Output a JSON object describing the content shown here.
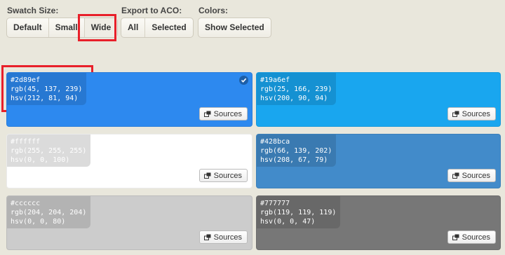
{
  "toolbar": {
    "swatch_size": {
      "label": "Swatch Size:",
      "options": [
        "Default",
        "Small",
        "Wide"
      ],
      "selected": "Wide"
    },
    "export": {
      "label": "Export to ACO:",
      "options": [
        "All",
        "Selected"
      ]
    },
    "colors": {
      "label": "Colors:",
      "show_selected": "Show Selected"
    }
  },
  "swatches": [
    {
      "hex": "#2d89ef",
      "rgb": "rgb(45, 137, 239)",
      "hsv": "hsv(212, 81, 94)",
      "color": "#2d89ef",
      "text_color": "#ffffff",
      "selected": true,
      "sources_label": "Sources"
    },
    {
      "hex": "#19a6ef",
      "rgb": "rgb(25, 166, 239)",
      "hsv": "hsv(200, 90, 94)",
      "color": "#19a6ef",
      "text_color": "#ffffff",
      "selected": false,
      "sources_label": "Sources"
    },
    {
      "hex": "#ffffff",
      "rgb": "rgb(255, 255, 255)",
      "hsv": "hsv(0, 0, 100)",
      "color": "#ffffff",
      "text_color": "#ffffff",
      "selected": false,
      "sources_label": "Sources"
    },
    {
      "hex": "#428bca",
      "rgb": "rgb(66, 139, 202)",
      "hsv": "hsv(208, 67, 79)",
      "color": "#428bca",
      "text_color": "#ffffff",
      "selected": false,
      "sources_label": "Sources"
    },
    {
      "hex": "#cccccc",
      "rgb": "rgb(204, 204, 204)",
      "hsv": "hsv(0, 0, 80)",
      "color": "#cccccc",
      "text_color": "#ffffff",
      "selected": false,
      "sources_label": "Sources"
    },
    {
      "hex": "#777777",
      "rgb": "rgb(119, 119, 119)",
      "hsv": "hsv(0, 0, 47)",
      "color": "#777777",
      "text_color": "#ffffff",
      "selected": false,
      "sources_label": "Sources"
    }
  ],
  "icons": {
    "selected_check": "check-icon",
    "sources": "external-link-icon"
  },
  "colors": {
    "highlight": "#e8202a",
    "page_background": "#e9e7dc"
  }
}
